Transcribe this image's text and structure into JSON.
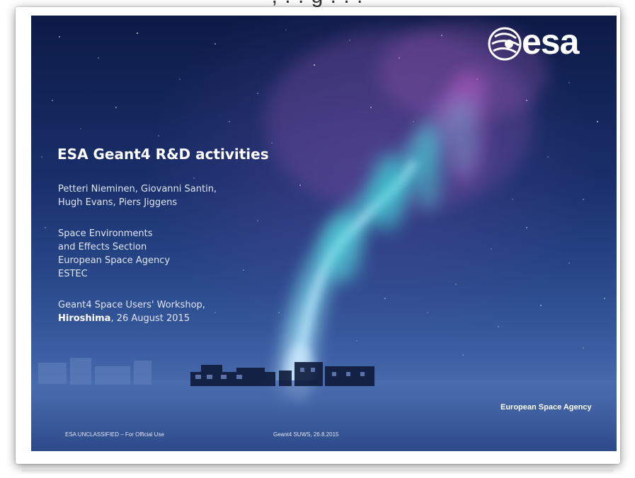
{
  "slide": {
    "logo_text": "esa",
    "title": "ESA Geant4 R&D activities",
    "authors": [
      "Petteri Nieminen, Giovanni Santin,",
      "Hugh Evans, Piers Jiggens"
    ],
    "affiliation": [
      "Space Environments",
      "and Effects Section",
      "European Space Agency",
      "ESTEC"
    ],
    "event_line1": "Geant4 Space Users' Workshop,",
    "event_city": "Hiroshima",
    "event_date": ", 26 August 2015",
    "agency_label": "European Space Agency",
    "footer_left": "ESA UNCLASSIFIED – For Official Use",
    "footer_center": "Geant4 SUWS, 26.8.2015"
  },
  "colors": {
    "sky_top": "#0c1a45",
    "sky_bottom": "#4e70b0",
    "aurora_cyan": "#3fd6d8",
    "aurora_magenta": "#b455b8",
    "text": "#ffffff"
  },
  "icons": {
    "logo": "esa-logo-icon"
  }
}
